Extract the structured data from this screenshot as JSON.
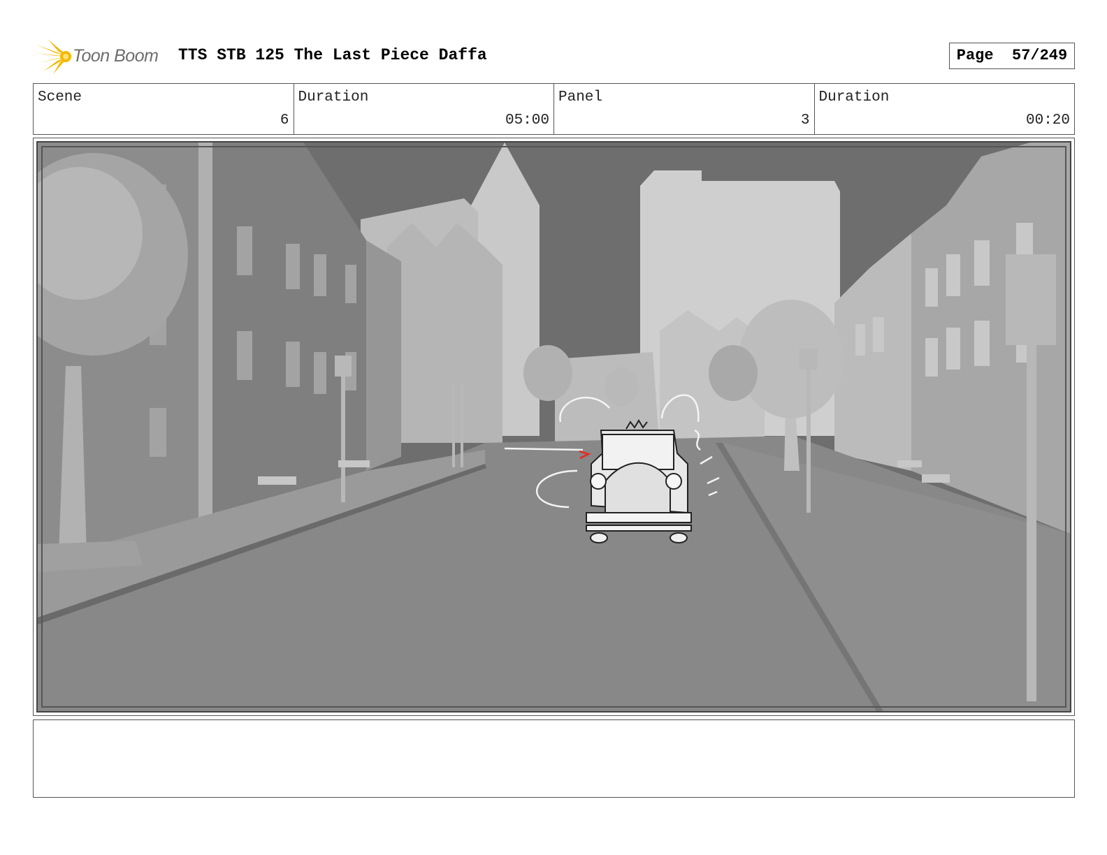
{
  "header": {
    "logo_text": "Toon Boom",
    "title": "TTS STB 125 The Last Piece Daffa",
    "page_label": "Page",
    "page_value": "57/249"
  },
  "info": {
    "scene_label": "Scene",
    "scene_value": "6",
    "scene_duration_label": "Duration",
    "scene_duration_value": "05:00",
    "panel_label": "Panel",
    "panel_value": "3",
    "panel_duration_label": "Duration",
    "panel_duration_value": "00:20"
  },
  "colors": {
    "logo_accent": "#f5b800",
    "sketch_red": "#d9342b"
  }
}
